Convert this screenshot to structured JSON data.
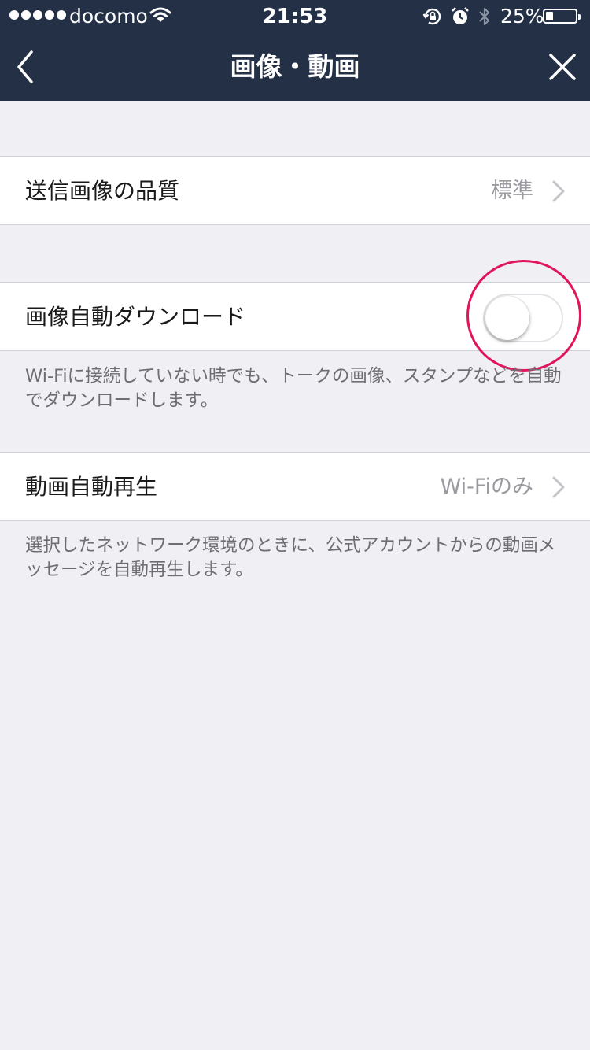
{
  "status_bar": {
    "carrier": "docomo",
    "time": "21:53",
    "battery_percent": "25%",
    "battery_level": 0.25,
    "icons": [
      "signal-dots-icon",
      "wifi-icon",
      "rotation-lock-icon",
      "alarm-icon",
      "bluetooth-icon",
      "battery-icon"
    ]
  },
  "nav": {
    "title": "画像・動画",
    "back_icon": "chevron-left-icon",
    "close_icon": "close-icon"
  },
  "settings": {
    "send_quality": {
      "label": "送信画像の品質",
      "value": "標準"
    },
    "auto_download": {
      "label": "画像自動ダウンロード",
      "enabled": false,
      "note": "Wi-Fiに接続していない時でも、トークの画像、スタンプなどを自動でダウンロードします。"
    },
    "autoplay": {
      "label": "動画自動再生",
      "value": "Wi-Fiのみ",
      "note": "選択したネットワーク環境のときに、公式アカウントからの動画メッセージを自動再生します。"
    }
  },
  "colors": {
    "nav_background": "#233046",
    "page_background": "#efeff4",
    "highlight_ring": "#e0155b"
  }
}
